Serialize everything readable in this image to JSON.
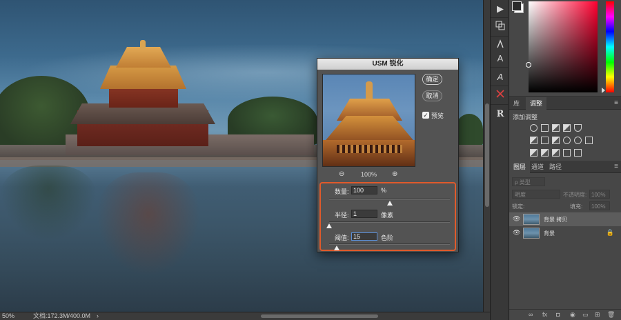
{
  "status_bar": {
    "zoom": "50%",
    "document": "文档:172.3M/400.0M",
    "arrow": "›"
  },
  "dialog": {
    "title": "USM 锐化",
    "ok_label": "确定",
    "cancel_label": "取消",
    "preview_label": "预览",
    "preview_checked": true,
    "zoom_percent": "100%",
    "zoom_out_icon": "zoom-out-icon",
    "zoom_in_icon": "zoom-in-icon",
    "params": [
      {
        "label": "数量:",
        "value": "100",
        "unit": "%",
        "slider_fraction": 0.5
      },
      {
        "label": "半径:",
        "value": "1",
        "unit": "像素",
        "slider_fraction": 0.0
      },
      {
        "label": "阈值:",
        "value": "15",
        "unit": "色阶",
        "slider_fraction": 0.06
      }
    ]
  },
  "tools": [
    "play-icon",
    "clone-source-icon",
    "character-style-icon",
    "paragraph-style-icon",
    "glyphs-icon",
    "ruler-cross-icon",
    "timeline-icon"
  ],
  "tools_text": {
    "play": "▶",
    "character": "A",
    "glyph": "A",
    "timeline_letter": "R"
  },
  "adjustments_panel": {
    "tabs": [
      "库",
      "调整"
    ],
    "active_tab": "调整",
    "label": "添加调整"
  },
  "layers_panel": {
    "tabs": [
      "图层",
      "通道",
      "路径"
    ],
    "active_tab": "图层",
    "filter_placeholder": "ρ 类型",
    "blend_mode": "明度",
    "opacity_label": "不透明度:",
    "opacity_value": "100%",
    "lock_label": "锁定:",
    "fill_label": "填充:",
    "fill_value": "100%",
    "layers": [
      {
        "name": "背景 拷贝",
        "visible": true,
        "selected": true,
        "locked": false
      },
      {
        "name": "背景",
        "visible": true,
        "selected": false,
        "locked": true
      }
    ],
    "footer": [
      "∞",
      "fx",
      "◘",
      "◉",
      "▭",
      "⊞",
      "🗑"
    ]
  },
  "colors": {
    "accent_highlight": "#e05a2b",
    "focus": "#5b8fd6"
  }
}
